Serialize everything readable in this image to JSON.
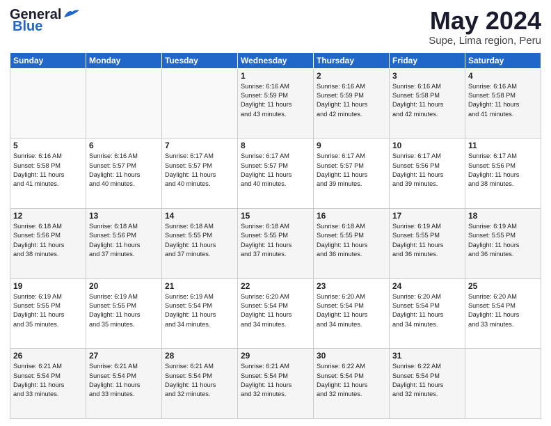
{
  "logo": {
    "line1": "General",
    "line2": "Blue"
  },
  "header": {
    "month": "May 2024",
    "location": "Supe, Lima region, Peru"
  },
  "weekdays": [
    "Sunday",
    "Monday",
    "Tuesday",
    "Wednesday",
    "Thursday",
    "Friday",
    "Saturday"
  ],
  "weeks": [
    [
      {
        "day": "",
        "info": ""
      },
      {
        "day": "",
        "info": ""
      },
      {
        "day": "",
        "info": ""
      },
      {
        "day": "1",
        "info": "Sunrise: 6:16 AM\nSunset: 5:59 PM\nDaylight: 11 hours\nand 43 minutes."
      },
      {
        "day": "2",
        "info": "Sunrise: 6:16 AM\nSunset: 5:59 PM\nDaylight: 11 hours\nand 42 minutes."
      },
      {
        "day": "3",
        "info": "Sunrise: 6:16 AM\nSunset: 5:58 PM\nDaylight: 11 hours\nand 42 minutes."
      },
      {
        "day": "4",
        "info": "Sunrise: 6:16 AM\nSunset: 5:58 PM\nDaylight: 11 hours\nand 41 minutes."
      }
    ],
    [
      {
        "day": "5",
        "info": "Sunrise: 6:16 AM\nSunset: 5:58 PM\nDaylight: 11 hours\nand 41 minutes."
      },
      {
        "day": "6",
        "info": "Sunrise: 6:16 AM\nSunset: 5:57 PM\nDaylight: 11 hours\nand 40 minutes."
      },
      {
        "day": "7",
        "info": "Sunrise: 6:17 AM\nSunset: 5:57 PM\nDaylight: 11 hours\nand 40 minutes."
      },
      {
        "day": "8",
        "info": "Sunrise: 6:17 AM\nSunset: 5:57 PM\nDaylight: 11 hours\nand 40 minutes."
      },
      {
        "day": "9",
        "info": "Sunrise: 6:17 AM\nSunset: 5:57 PM\nDaylight: 11 hours\nand 39 minutes."
      },
      {
        "day": "10",
        "info": "Sunrise: 6:17 AM\nSunset: 5:56 PM\nDaylight: 11 hours\nand 39 minutes."
      },
      {
        "day": "11",
        "info": "Sunrise: 6:17 AM\nSunset: 5:56 PM\nDaylight: 11 hours\nand 38 minutes."
      }
    ],
    [
      {
        "day": "12",
        "info": "Sunrise: 6:18 AM\nSunset: 5:56 PM\nDaylight: 11 hours\nand 38 minutes."
      },
      {
        "day": "13",
        "info": "Sunrise: 6:18 AM\nSunset: 5:56 PM\nDaylight: 11 hours\nand 37 minutes."
      },
      {
        "day": "14",
        "info": "Sunrise: 6:18 AM\nSunset: 5:55 PM\nDaylight: 11 hours\nand 37 minutes."
      },
      {
        "day": "15",
        "info": "Sunrise: 6:18 AM\nSunset: 5:55 PM\nDaylight: 11 hours\nand 37 minutes."
      },
      {
        "day": "16",
        "info": "Sunrise: 6:18 AM\nSunset: 5:55 PM\nDaylight: 11 hours\nand 36 minutes."
      },
      {
        "day": "17",
        "info": "Sunrise: 6:19 AM\nSunset: 5:55 PM\nDaylight: 11 hours\nand 36 minutes."
      },
      {
        "day": "18",
        "info": "Sunrise: 6:19 AM\nSunset: 5:55 PM\nDaylight: 11 hours\nand 36 minutes."
      }
    ],
    [
      {
        "day": "19",
        "info": "Sunrise: 6:19 AM\nSunset: 5:55 PM\nDaylight: 11 hours\nand 35 minutes."
      },
      {
        "day": "20",
        "info": "Sunrise: 6:19 AM\nSunset: 5:55 PM\nDaylight: 11 hours\nand 35 minutes."
      },
      {
        "day": "21",
        "info": "Sunrise: 6:19 AM\nSunset: 5:54 PM\nDaylight: 11 hours\nand 34 minutes."
      },
      {
        "day": "22",
        "info": "Sunrise: 6:20 AM\nSunset: 5:54 PM\nDaylight: 11 hours\nand 34 minutes."
      },
      {
        "day": "23",
        "info": "Sunrise: 6:20 AM\nSunset: 5:54 PM\nDaylight: 11 hours\nand 34 minutes."
      },
      {
        "day": "24",
        "info": "Sunrise: 6:20 AM\nSunset: 5:54 PM\nDaylight: 11 hours\nand 34 minutes."
      },
      {
        "day": "25",
        "info": "Sunrise: 6:20 AM\nSunset: 5:54 PM\nDaylight: 11 hours\nand 33 minutes."
      }
    ],
    [
      {
        "day": "26",
        "info": "Sunrise: 6:21 AM\nSunset: 5:54 PM\nDaylight: 11 hours\nand 33 minutes."
      },
      {
        "day": "27",
        "info": "Sunrise: 6:21 AM\nSunset: 5:54 PM\nDaylight: 11 hours\nand 33 minutes."
      },
      {
        "day": "28",
        "info": "Sunrise: 6:21 AM\nSunset: 5:54 PM\nDaylight: 11 hours\nand 32 minutes."
      },
      {
        "day": "29",
        "info": "Sunrise: 6:21 AM\nSunset: 5:54 PM\nDaylight: 11 hours\nand 32 minutes."
      },
      {
        "day": "30",
        "info": "Sunrise: 6:22 AM\nSunset: 5:54 PM\nDaylight: 11 hours\nand 32 minutes."
      },
      {
        "day": "31",
        "info": "Sunrise: 6:22 AM\nSunset: 5:54 PM\nDaylight: 11 hours\nand 32 minutes."
      },
      {
        "day": "",
        "info": ""
      }
    ]
  ]
}
